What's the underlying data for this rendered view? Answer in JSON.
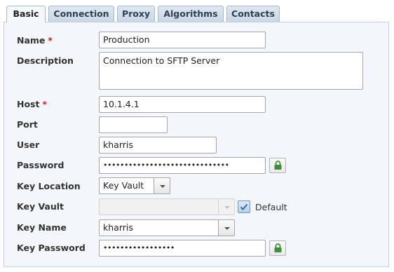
{
  "tabs": [
    {
      "label": "Basic",
      "active": true
    },
    {
      "label": "Connection",
      "active": false
    },
    {
      "label": "Proxy",
      "active": false
    },
    {
      "label": "Algorithms",
      "active": false
    },
    {
      "label": "Contacts",
      "active": false
    }
  ],
  "form": {
    "name": {
      "label": "Name",
      "required_mark": "*",
      "value": "Production"
    },
    "description": {
      "label": "Description",
      "value": "Connection to SFTP Server"
    },
    "host": {
      "label": "Host",
      "required_mark": "*",
      "value": "10.1.4.1"
    },
    "port": {
      "label": "Port",
      "value": ""
    },
    "user": {
      "label": "User",
      "value": "kharris"
    },
    "password": {
      "label": "Password",
      "value": "••••••••••••••••••••••••••••••"
    },
    "key_location": {
      "label": "Key Location",
      "value": "Key Vault"
    },
    "key_vault": {
      "label": "Key Vault",
      "value": "",
      "disabled": true,
      "default_label": "Default",
      "default_checked": true
    },
    "key_name": {
      "label": "Key Name",
      "value": "kharris"
    },
    "key_password": {
      "label": "Key Password",
      "value": "•••••••••••••••••"
    }
  },
  "icons": {
    "lock": "lock-icon",
    "dropdown": "chevron-down-icon",
    "check": "checkmark-icon"
  },
  "colors": {
    "required": "#d0202a",
    "lock": "#3e8e3e",
    "checkbox": "#2f6aa8"
  }
}
